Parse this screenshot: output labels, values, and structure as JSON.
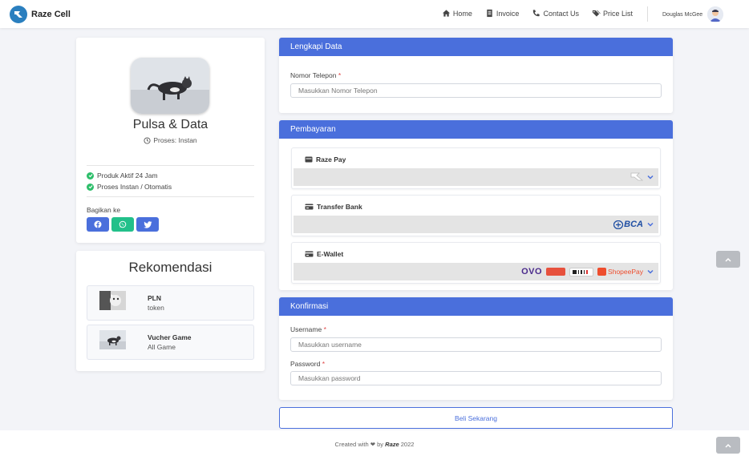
{
  "nav": {
    "brand": "Raze Cell",
    "links": [
      {
        "label": "Home",
        "icon": "home-icon"
      },
      {
        "label": "Invoice",
        "icon": "invoice-icon"
      },
      {
        "label": "Contact Us",
        "icon": "phone-icon"
      },
      {
        "label": "Price List",
        "icon": "tags-icon"
      }
    ],
    "user_name": "Douglas McGee"
  },
  "product": {
    "title": "Pulsa & Data",
    "process": "Proses: Instan",
    "features": [
      "Produk Aktif 24 Jam",
      "Proses Instan / Otomatis"
    ],
    "share_label": "Bagikan ke",
    "share": [
      "facebook-icon",
      "whatsapp-icon",
      "twitter-icon"
    ]
  },
  "recommend": {
    "title": "Rekomendasi",
    "items": [
      {
        "name": "PLN",
        "desc": "token"
      },
      {
        "name": "Vucher Game",
        "desc": "All Game"
      }
    ]
  },
  "form": {
    "section1_title": "Lengkapi Data",
    "phone_label": "Nomor Telepon",
    "phone_placeholder": "Masukkan Nomor Telepon",
    "section2_title": "Pembayaran",
    "payments": [
      {
        "name": "Raze Pay"
      },
      {
        "name": "Transfer Bank",
        "logo": "BCA"
      },
      {
        "name": "E-Wallet",
        "logos": [
          "OVO",
          "ShopeePay"
        ]
      }
    ],
    "section3_title": "Konfirmasi",
    "username_label": "Username",
    "username_placeholder": "Masukkan username",
    "password_label": "Password",
    "password_placeholder": "Masukkan password",
    "required_mark": "*",
    "submit_label": "Beli Sekarang"
  },
  "footer": {
    "prefix": "Created with",
    "heart": "❤",
    "by": "by",
    "brand": "Raze",
    "year": "2022"
  },
  "colors": {
    "primary": "#4a6fdc",
    "success": "#2dbe6a",
    "facebook": "#4a6fdc",
    "whatsapp": "#22c08a",
    "twitter": "#4a6fdc"
  }
}
